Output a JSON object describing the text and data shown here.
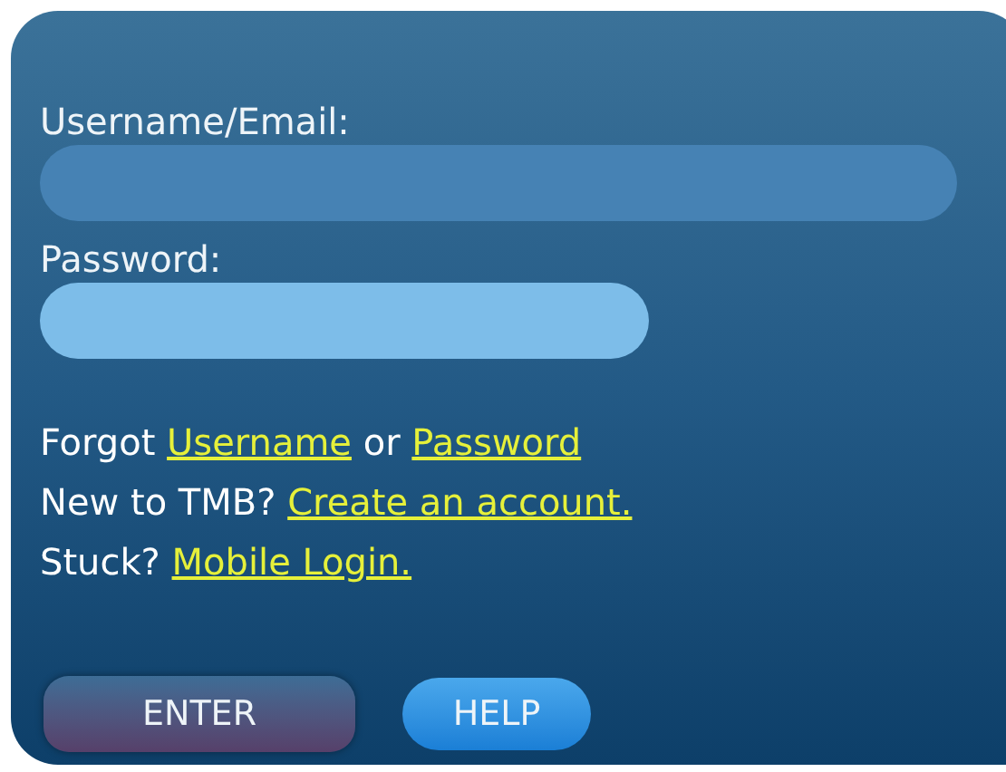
{
  "fields": [
    {
      "label": "Username/Email:",
      "focused": false
    },
    {
      "label": "Password:",
      "focused": true
    }
  ],
  "help_lines": [
    {
      "parts": [
        {
          "text": "Forgot ",
          "link": false
        },
        {
          "text": "Username",
          "link": true
        },
        {
          "text": " or ",
          "link": false
        },
        {
          "text": "Password",
          "link": true
        }
      ]
    },
    {
      "parts": [
        {
          "text": "New to TMB? ",
          "link": false
        },
        {
          "text": "Create an account.",
          "link": true
        }
      ]
    },
    {
      "parts": [
        {
          "text": "Stuck? ",
          "link": false
        },
        {
          "text": "Mobile Login.",
          "link": true
        }
      ]
    }
  ],
  "buttons": [
    {
      "label": "ENTER",
      "kind": "primary"
    },
    {
      "label": "HELP",
      "kind": "secondary"
    }
  ]
}
